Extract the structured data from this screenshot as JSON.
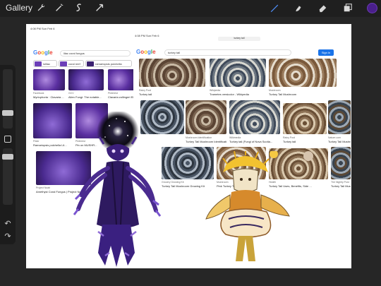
{
  "app": {
    "gallery_label": "Gallery",
    "colors": {
      "accent": "#4a1f8c",
      "brush_active": "#4f8ef7"
    },
    "icons": [
      "wrench-icon",
      "magic-wand-icon",
      "selection-s-icon",
      "transform-arrow-icon",
      "brush-icon",
      "smudge-icon",
      "eraser-icon",
      "layers-icon"
    ]
  },
  "sidebar": {
    "undo_icon": "↶",
    "redo_icon": "↷"
  },
  "shot1": {
    "status": "4:08 PM   Sun Feb 6",
    "search_query": "lilac coral fungus",
    "chips": [
      "lolilac",
      "coral reef",
      "ramariopsis pulchella"
    ],
    "results": [
      {
        "source": "Facebook",
        "title": "Myriophoria · Clavaria ..."
      },
      {
        "source": "GCV",
        "title": "Alien Fungi: The notable..."
      },
      {
        "source": "Pinterest",
        "title": "Clavaria zollingeri Elf..."
      },
      {
        "source": "Flickr",
        "title": "Ramariopsis pulchella Lil..."
      },
      {
        "source": "Pinterest",
        "title": "Pin on MUSHR..."
      },
      {
        "source": "Project Noah",
        "title": "Amethyst Coral Fungus | Project Noah"
      }
    ]
  },
  "shot2": {
    "status": "4:08 PM   Sun Feb 6",
    "url": "turkey tail",
    "search_query": "turkey tail",
    "signin_label": "Sign in",
    "results": [
      {
        "source": "Rainy Post",
        "title": "Turkey tail"
      },
      {
        "source": "Wikipedia",
        "title": "Trametes versicolor - Wikipedia"
      },
      {
        "source": "Mushroom",
        "title": "Turkey Tail Mushroom"
      },
      {
        "source": "Mushroom Identification",
        "title": "Turkey Tail Mushroom Identification..."
      },
      {
        "source": "Wikimedia",
        "title": "Turkey tail (Fungi of Nova Scotia..."
      },
      {
        "source": "Rainy Post",
        "title": "Turkey tail"
      },
      {
        "source": "Nature.com",
        "title": "Turkey Tail Mushroom Lo..."
      },
      {
        "source": "Grocery Growing Kit",
        "title": "Turkey Tail Mushroom Growing Kit"
      },
      {
        "source": "Mushroom",
        "title": "Pink Turkey Tail..."
      },
      {
        "source": "Health",
        "title": "Turkey Tail Uses, Benefits, Side ..."
      },
      {
        "source": "The Nightly Post",
        "title": "Turkey Tail Mushro..."
      }
    ]
  }
}
